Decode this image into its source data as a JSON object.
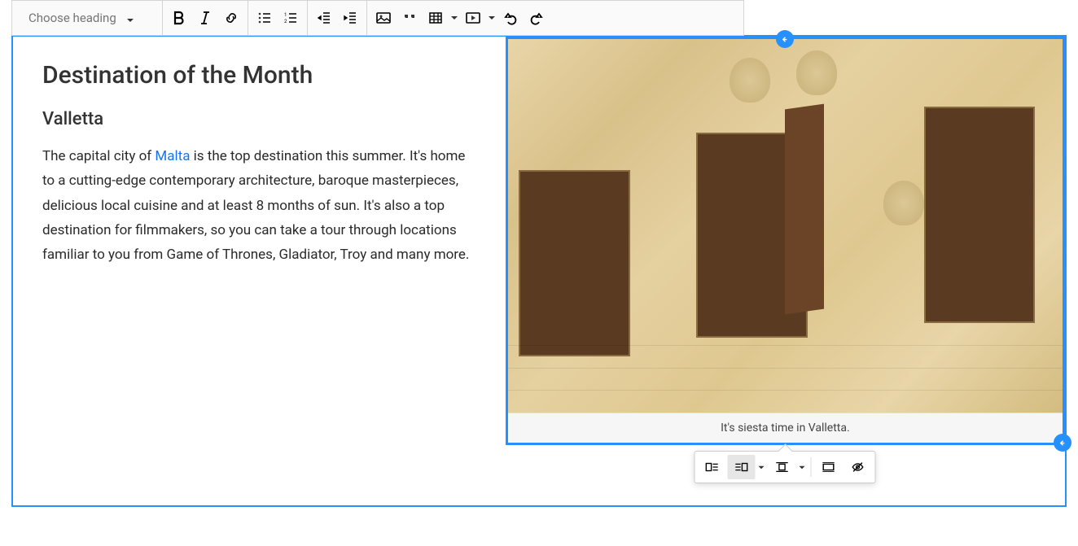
{
  "toolbar": {
    "heading_placeholder": "Choose heading"
  },
  "content": {
    "h1": "Destination of the Month",
    "h2": "Valletta",
    "para_pre": "The capital city of ",
    "para_link": "Malta",
    "para_post": " is the top destination this summer. It's home to a cutting-edge contemporary architecture, baroque masterpieces, delicious local cuisine and at least 8 months of sun. It's also a top destination for filmmakers, so you can take a tour through locations familiar to you from Game of Thrones, Gladiator, Troy and many more."
  },
  "figure": {
    "caption": "It's siesta time in Valletta."
  }
}
